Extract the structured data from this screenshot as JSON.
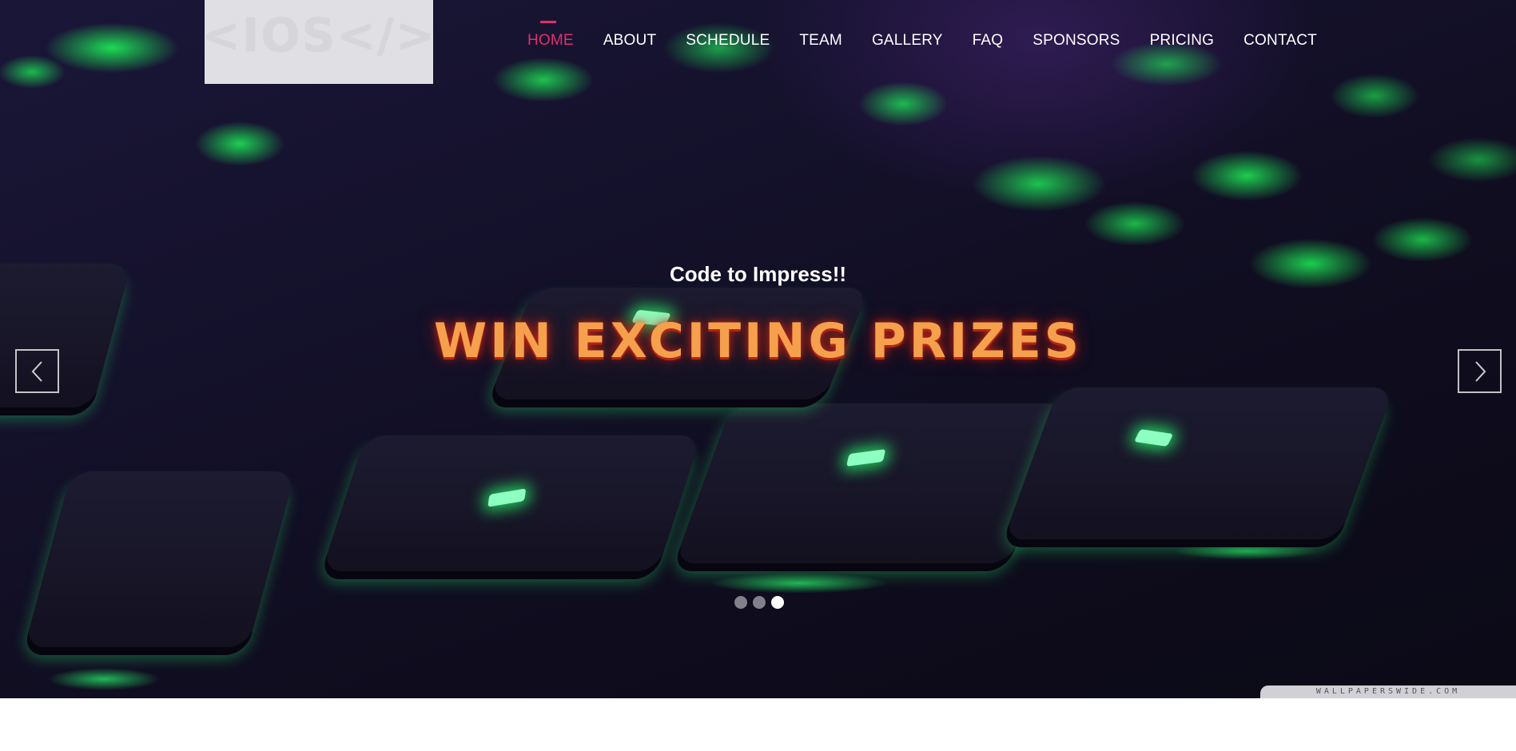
{
  "header": {
    "logo_text": "<IOS</>",
    "nav": [
      {
        "label": "HOME",
        "active": true
      },
      {
        "label": "ABOUT",
        "active": false
      },
      {
        "label": "SCHEDULE",
        "active": false
      },
      {
        "label": "TEAM",
        "active": false
      },
      {
        "label": "GALLERY",
        "active": false
      },
      {
        "label": "FAQ",
        "active": false
      },
      {
        "label": "SPONSORS",
        "active": false
      },
      {
        "label": "PRICING",
        "active": false
      },
      {
        "label": "CONTACT",
        "active": false
      }
    ]
  },
  "hero": {
    "tagline": "Code to Impress!!",
    "headline": "WIN EXCITING PRIZES",
    "watermark": "WALLPAPERSWIDE.COM",
    "prev_icon": "chevron-left-icon",
    "next_icon": "chevron-right-icon",
    "slide_count": 3,
    "active_slide": 3
  },
  "colors": {
    "accent": "#e0306a",
    "headline": "#f5a04c",
    "headline_glow": "#b32316",
    "key_glow": "#28ff6e"
  }
}
